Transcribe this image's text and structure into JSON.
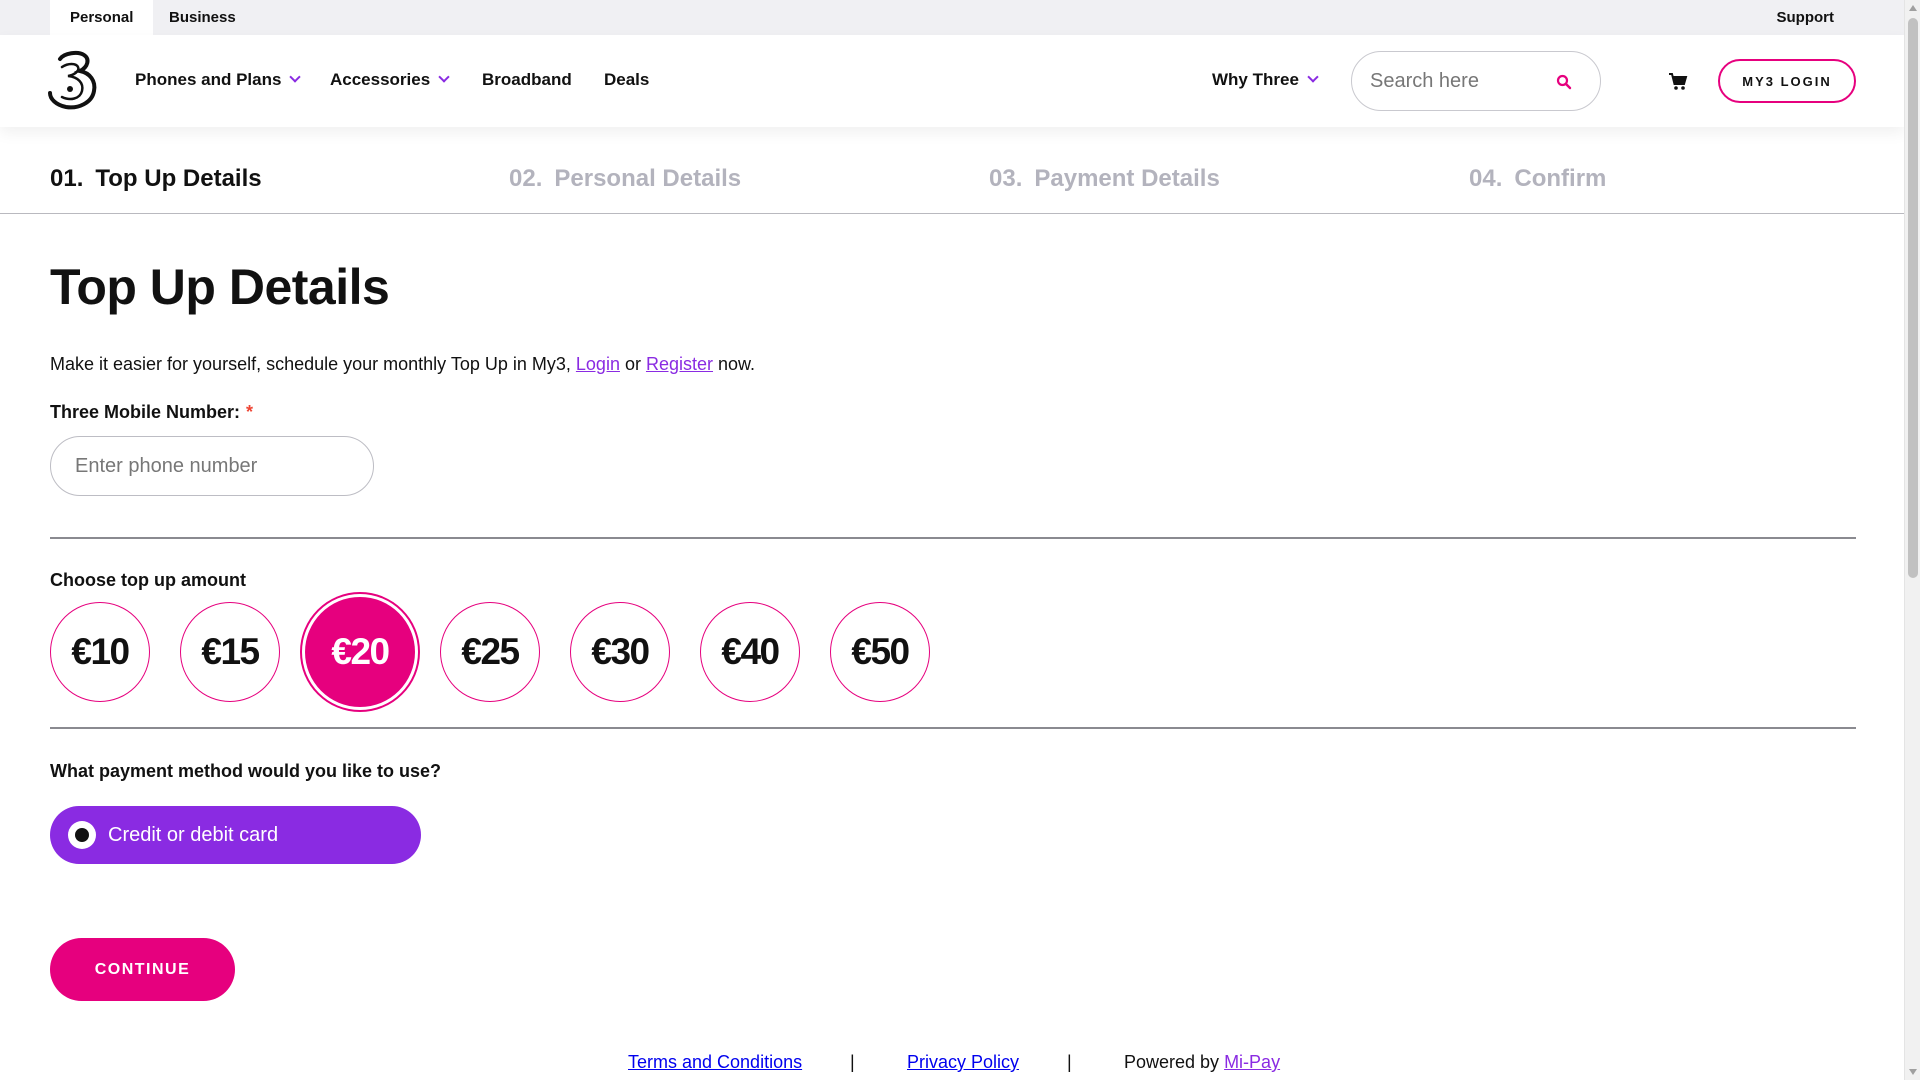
{
  "utility": {
    "tabs": [
      "Personal",
      "Business"
    ],
    "support": "Support"
  },
  "nav": {
    "items": [
      "Phones and Plans",
      "Accessories",
      "Broadband",
      "Deals"
    ],
    "why_three": "Why Three",
    "search_placeholder": "Search here",
    "login": "MY3 LOGIN"
  },
  "steps": [
    {
      "num": "01.",
      "label": "Top Up Details",
      "active": true
    },
    {
      "num": "02.",
      "label": "Personal Details",
      "active": false
    },
    {
      "num": "03.",
      "label": "Payment Details",
      "active": false
    },
    {
      "num": "04.",
      "label": "Confirm",
      "active": false
    }
  ],
  "main": {
    "title": "Top Up Details",
    "intro_before": "Make it easier for yourself, schedule your monthly Top Up in My3, ",
    "login_link": "Login",
    "intro_or": " or ",
    "register_link": "Register",
    "intro_after": " now.",
    "phone_label": "Three Mobile Number:",
    "required_mark": "*",
    "phone_placeholder": "Enter phone number",
    "amount_label": "Choose top up amount",
    "amounts": [
      "€10",
      "€15",
      "€20",
      "€25",
      "€30",
      "€40",
      "€50"
    ],
    "selected_amount": "€20",
    "payment_label": "What payment method would you like to use?",
    "payment_option": "Credit or debit card",
    "continue": "CONTINUE"
  },
  "footer": {
    "terms": "Terms and Conditions",
    "separator": "|",
    "privacy": "Privacy Policy",
    "powered_by": "Powered by ",
    "mipay": "Mi-Pay"
  },
  "colors": {
    "brand_pink": "#e6007e",
    "brand_purple": "#8a2be2"
  }
}
